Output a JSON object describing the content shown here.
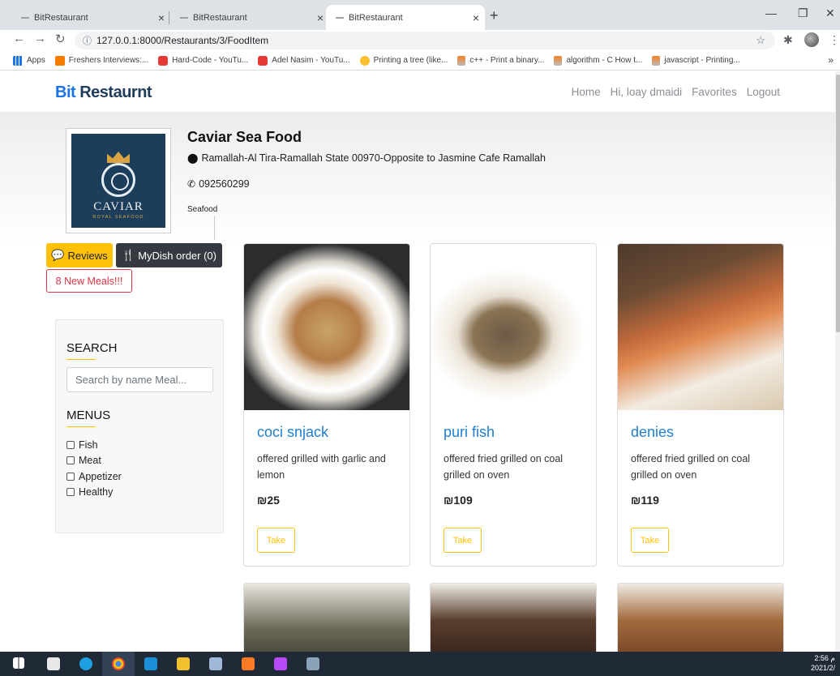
{
  "browser": {
    "tabs": [
      {
        "title": "BitRestaurant",
        "active": false
      },
      {
        "title": "BitRestaurant",
        "active": false
      },
      {
        "title": "BitRestaurant",
        "active": true
      }
    ],
    "url": "127.0.0.1:8000/Restaurants/3/FoodItem",
    "bookmarks": [
      {
        "label": "Apps",
        "icon": "apps-grid-icon"
      },
      {
        "label": "Freshers Interviews:...",
        "icon": "blogger-icon"
      },
      {
        "label": "Hard-Code - YouTu...",
        "icon": "youtube-icon"
      },
      {
        "label": "Adel Nasim - YouTu...",
        "icon": "youtube-icon"
      },
      {
        "label": "Printing a tree (like...",
        "icon": "tree-icon"
      },
      {
        "label": "c++ - Print a binary...",
        "icon": "stackoverflow-icon"
      },
      {
        "label": "algorithm - C How t...",
        "icon": "stackoverflow-icon"
      },
      {
        "label": "javascript - Printing...",
        "icon": "stackoverflow-icon"
      }
    ]
  },
  "nav": {
    "brand_prefix": "Bit",
    "brand_rest": " Restaurnt",
    "links": [
      "Home",
      "Hi, loay dmaidi",
      "Favorites",
      "Logout"
    ]
  },
  "restaurant": {
    "name": "Caviar Sea Food",
    "address": "Ramallah-Al Tira-Ramallah State 00970-Opposite to Jasmine Cafe Ramallah",
    "phone": "092560299",
    "category": "Seafood",
    "logo_text": "CAVIAR",
    "logo_subtext": "ROYAL SEAFOOD"
  },
  "actions": {
    "reviews": "Reviews",
    "mydish": "MyDish order (0)",
    "new_meals": "8 New Meals!!!"
  },
  "sidebar": {
    "search_title": "SEARCH",
    "search_placeholder": "Search by name Meal...",
    "menus_title": "MENUS",
    "menus": [
      "Fish",
      "Meat",
      "Appetizer",
      "Healthy"
    ]
  },
  "meals": [
    {
      "name": "coci snjack",
      "desc": "offered grilled with garlic and lemon",
      "price": "₪25",
      "take": "Take"
    },
    {
      "name": "puri fish",
      "desc": "offered fried grilled on coal grilled on oven",
      "price": "₪109",
      "take": "Take"
    },
    {
      "name": "denies",
      "desc": "offered fried grilled on coal grilled on oven",
      "price": "₪119",
      "take": "Take"
    }
  ],
  "taskbar": {
    "time": "2:56 م",
    "date": "2021/2/"
  },
  "colors": {
    "accent": "#ffc107",
    "link": "#1e7fd1",
    "danger": "#dc3545",
    "dark": "#343a40"
  }
}
